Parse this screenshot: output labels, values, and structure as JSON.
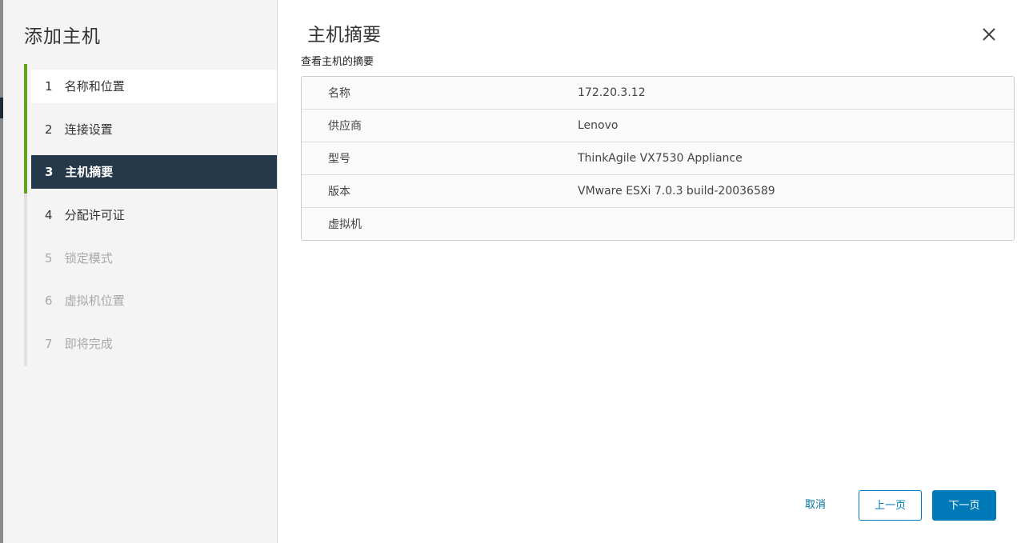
{
  "wizard": {
    "title": "添加主机",
    "steps": [
      {
        "num": "1",
        "label": "名称和位置",
        "state": "completed"
      },
      {
        "num": "2",
        "label": "连接设置",
        "state": "completed"
      },
      {
        "num": "3",
        "label": "主机摘要",
        "state": "current"
      },
      {
        "num": "4",
        "label": "分配许可证",
        "state": "pending"
      },
      {
        "num": "5",
        "label": "锁定模式",
        "state": "disabled"
      },
      {
        "num": "6",
        "label": "虚拟机位置",
        "state": "disabled"
      },
      {
        "num": "7",
        "label": "即将完成",
        "state": "disabled"
      }
    ]
  },
  "page": {
    "title": "主机摘要",
    "subtitle": "查看主机的摘要",
    "summary": [
      {
        "key": "名称",
        "value": "172.20.3.12"
      },
      {
        "key": "供应商",
        "value": "Lenovo"
      },
      {
        "key": "型号",
        "value": "ThinkAgile VX7530 Appliance"
      },
      {
        "key": "版本",
        "value": "VMware ESXi 7.0.3 build-20036589"
      },
      {
        "key": "虚拟机",
        "value": ""
      }
    ]
  },
  "footer": {
    "cancel_label": "取消",
    "back_label": "上一页",
    "next_label": "下一页"
  },
  "icons": {
    "close": "close-icon"
  },
  "colors": {
    "accent": "#0079b8",
    "progress": "#62a420",
    "current_step_bg": "#25394a"
  }
}
